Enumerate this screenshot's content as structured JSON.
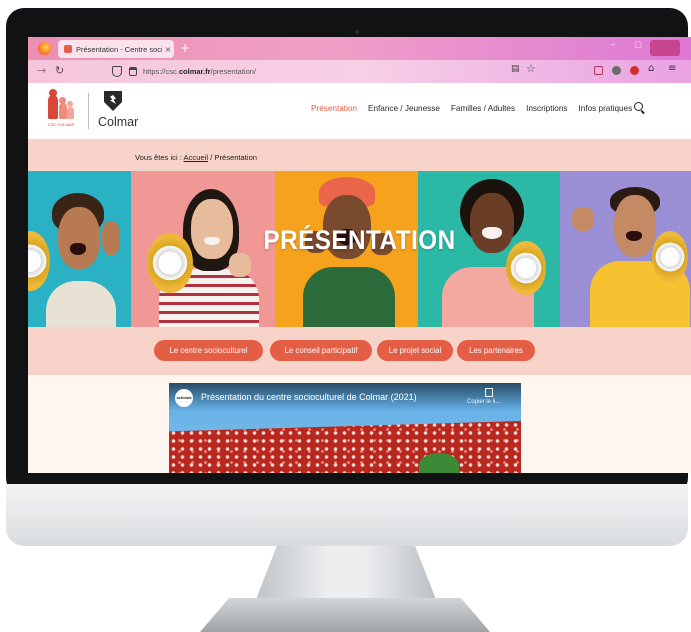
{
  "browser": {
    "tab_title": "Présentation - Centre sociocult",
    "tab_close": "×",
    "new_tab": "+",
    "url_prefix": "https://csc.",
    "url_domain": "colmar.fr",
    "url_path": "/presentation/",
    "window_minimize": "–",
    "window_maximize": "◻",
    "icons": [
      "firefox-logo",
      "back-arrow",
      "reload",
      "shield",
      "lock",
      "reader-view",
      "bookmark-star",
      "pocket",
      "extension",
      "extension",
      "extension",
      "menu"
    ]
  },
  "site": {
    "logo_caption": "CSC COLMAR",
    "logo_text": "Colmar",
    "nav": [
      "Présentation",
      "Enfance / Jeunesse",
      "Familles / Adultes",
      "Inscriptions",
      "Infos pratiques"
    ],
    "active_nav": "Présentation",
    "accent_color": "#e45d45"
  },
  "breadcrumb": {
    "prefix": "Vous êtes ici : ",
    "home": "Accueil",
    "separator": " / ",
    "current": "Présentation"
  },
  "hero": {
    "title": "PRÉSENTATION",
    "panel_colors": [
      "#2ab1c3",
      "#ef9896",
      "#f6a21d",
      "#2bb9a6",
      "#9b8fd6"
    ]
  },
  "subnav": {
    "buttons": [
      "Le centre socioculturel",
      "Le conseil participatif",
      "Le projet social",
      "Les partenaires"
    ]
  },
  "video": {
    "channel": "schlouk",
    "title": "Présentation du centre socioculturel de Colmar (2021)",
    "copy_label": "Copier le li..."
  }
}
